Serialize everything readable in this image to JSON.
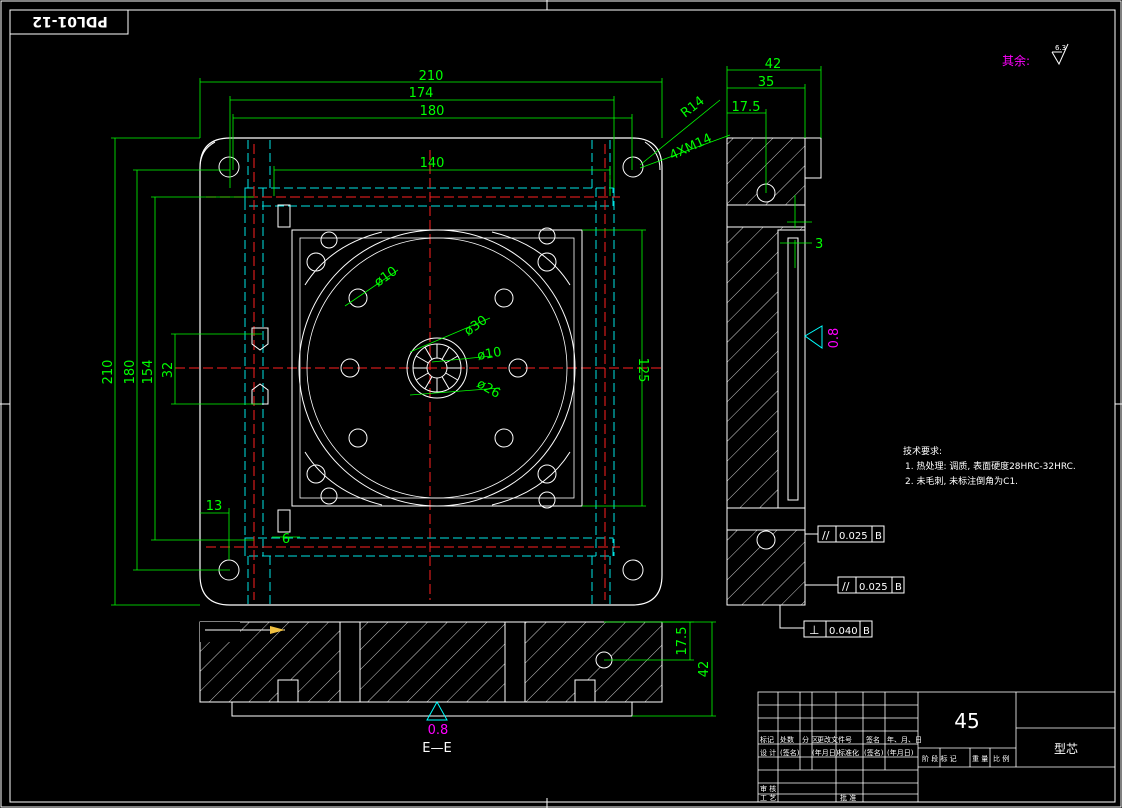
{
  "drawing": {
    "code_stamp": "PDL01-12",
    "roughness_note_label": "其余:",
    "roughness_note_value": "6.3",
    "section_label": "E—E",
    "material": "45",
    "part_name": "型芯",
    "tech_req_title": "技术要求:",
    "tech_req_1": "1. 热处理: 调质, 表面硬度28HRC-32HRC.",
    "tech_req_2": "2. 未毛刺, 未标注倒角为C1."
  },
  "dimensions": {
    "top_210": "210",
    "top_174": "174",
    "top_180": "180",
    "top_140": "140",
    "r14": "R14",
    "holes": "4XM14",
    "left_210": "210",
    "left_180": "180",
    "left_154": "154",
    "left_32": "32",
    "left_13": "13",
    "left_6": "6",
    "right_125": "125",
    "dia_10_a": "ø10",
    "dia_30": "ø30",
    "dia_10_b": "ø10",
    "dia_26": "ø26",
    "side_42": "42",
    "side_35": "35",
    "side_17_5": "17.5",
    "side_3": "3",
    "bottom_17_5": "17.5",
    "bottom_42": "42",
    "rough_side": "0.8",
    "rough_bottom": "0.8"
  },
  "tolerances": {
    "par_1": {
      "sym": "//",
      "value": "0.025",
      "datum": "B"
    },
    "par_2": {
      "sym": "//",
      "value": "0.025",
      "datum": "B"
    },
    "perp": {
      "sym": "⊥",
      "value": "0.040",
      "datum": "B"
    }
  },
  "title_block": {
    "r1": [
      "标记",
      "处数",
      "分 区",
      "更改文件号",
      "签名",
      "年、月、日"
    ],
    "r2": [
      "设 计",
      "(签名)",
      "(年月日)",
      "标准化",
      "(签名)",
      "(年月日)"
    ],
    "r3_left": [
      "审 核",
      "工 艺"
    ],
    "r3_mid": "批 准",
    "stage_row": [
      "阶 段 标 记",
      "重 量",
      "比 例"
    ]
  }
}
